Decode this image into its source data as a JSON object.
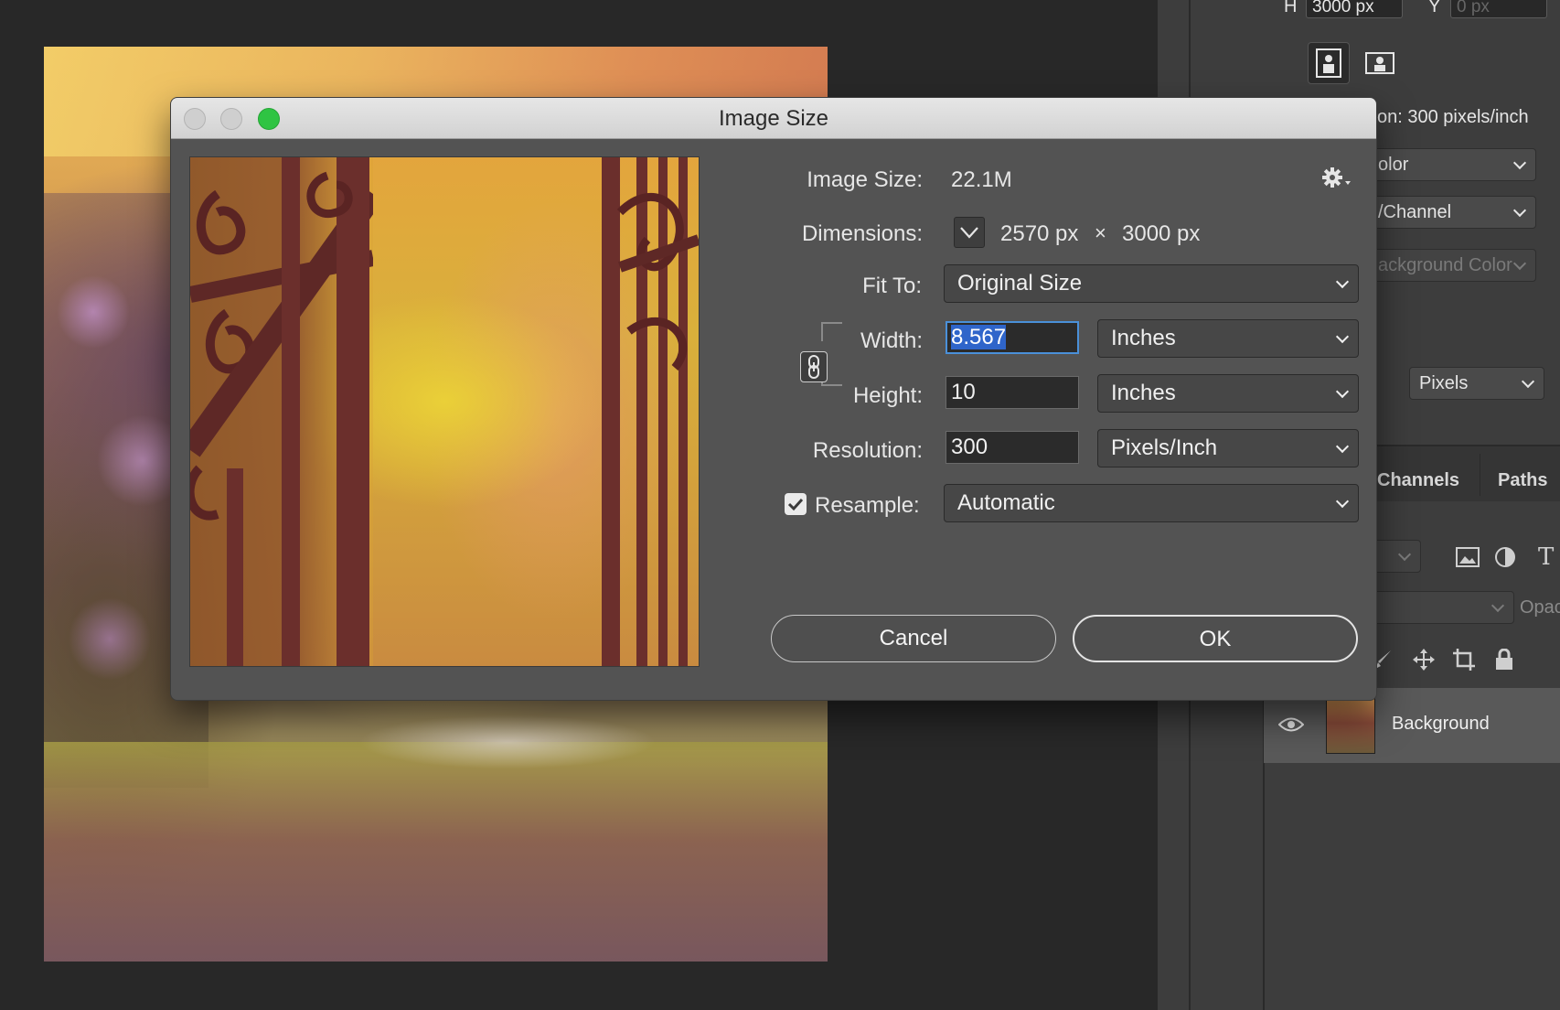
{
  "dialog": {
    "title": "Image Size",
    "image_size_label": "Image Size:",
    "image_size_value": "22.1M",
    "dimensions_label": "Dimensions:",
    "dim_width": "2570 px",
    "dim_times": "×",
    "dim_height": "3000 px",
    "fit_to_label": "Fit To:",
    "fit_to_value": "Original Size",
    "width_label": "Width:",
    "width_value": "8.567",
    "width_unit": "Inches",
    "height_label": "Height:",
    "height_value": "10",
    "height_unit": "Inches",
    "resolution_label": "Resolution:",
    "resolution_value": "300",
    "resolution_unit": "Pixels/Inch",
    "resample_label": "Resample:",
    "resample_checked": true,
    "resample_value": "Automatic",
    "cancel_label": "Cancel",
    "ok_label": "OK",
    "icons": {
      "gear": "gear-icon",
      "link": "link-icon",
      "dimensions_toggle": "chevron-down-icon"
    }
  },
  "right_panel": {
    "h_label": "H",
    "h_value": "3000 px",
    "y_label": "Y",
    "y_placeholder": "0 px",
    "resolution_text": "on: 300 pixels/inch",
    "color_mode": "olor",
    "bit_depth": "/Channel",
    "fill": "ackground Color",
    "units": "Pixels",
    "tabs": [
      "Channels",
      "Paths"
    ],
    "opacity_label": "Opac",
    "layer_name": "Background",
    "icons": [
      "portrait-orientation-icon",
      "landscape-orientation-icon",
      "image-filter-icon",
      "adjustment-filter-icon",
      "type-filter-icon",
      "brush-icon",
      "move-icon",
      "crop-icon",
      "lock-icon",
      "eye-icon"
    ]
  },
  "colors": {
    "canvas_bg": "#282828",
    "dialog_bg": "#535353",
    "selection": "#2f65ca",
    "focus_ring": "#4a90d9",
    "zoom_button": "#2fc443"
  }
}
